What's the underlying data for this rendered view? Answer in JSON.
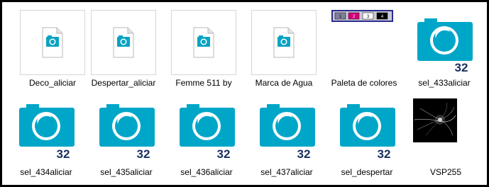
{
  "window": {
    "border_color": "#000000"
  },
  "files": [
    {
      "name": "Deco_aliciar",
      "icon": "file-image-icon"
    },
    {
      "name": "Despertar_aliciar",
      "icon": "file-image-icon"
    },
    {
      "name": "Femme 511 by",
      "icon": "file-image-icon"
    },
    {
      "name": "Marca de Agua",
      "icon": "file-image-icon"
    },
    {
      "name": "Paleta de colores",
      "icon": "palette-thumbnail",
      "swatch_labels": [
        "1",
        "2",
        "3",
        "4"
      ]
    },
    {
      "name": "sel_433aliciar",
      "icon": "selection-file-icon",
      "badge": "32"
    },
    {
      "name": "sel_434aliciar",
      "icon": "selection-file-icon",
      "badge": "32"
    },
    {
      "name": "sel_435aliciar",
      "icon": "selection-file-icon",
      "badge": "32"
    },
    {
      "name": "sel_436aliciar",
      "icon": "selection-file-icon",
      "badge": "32"
    },
    {
      "name": "sel_437aliciar",
      "icon": "selection-file-icon",
      "badge": "32"
    },
    {
      "name": "sel_despertar",
      "icon": "selection-file-icon",
      "badge": "32"
    },
    {
      "name": "VSP255",
      "icon": "image-thumbnail"
    }
  ],
  "colors": {
    "accent": "#00a6c8",
    "badge_text": "#1b2f5e",
    "palette_frame": "#2b2b8f"
  }
}
